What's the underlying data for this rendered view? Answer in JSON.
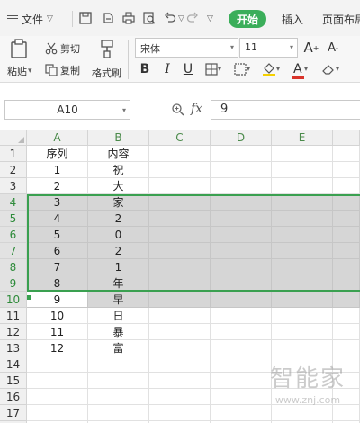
{
  "menubar": {
    "file_label": "文件",
    "start_tab": "开始",
    "insert_tab": "插入",
    "page_layout_tab": "页面布局"
  },
  "ribbon": {
    "paste_label": "粘贴",
    "cut_label": "剪切",
    "copy_label": "复制",
    "format_painter_label": "格式刷",
    "font_name": "宋体",
    "font_size": "11",
    "bold": "B",
    "italic": "I",
    "underline": "U",
    "increase_font": "A",
    "decrease_font": "A",
    "font_color_letter": "A"
  },
  "formula_bar": {
    "name_box": "A10",
    "fx": "fx",
    "value": "9"
  },
  "sheet": {
    "columns": [
      "A",
      "B",
      "C",
      "D",
      "E"
    ],
    "row_numbers": [
      "1",
      "2",
      "3",
      "4",
      "5",
      "6",
      "7",
      "8",
      "9",
      "10",
      "11",
      "12",
      "13",
      "14",
      "15",
      "16",
      "17",
      "18"
    ],
    "rows": [
      [
        "序列",
        "内容"
      ],
      [
        "1",
        "祝"
      ],
      [
        "2",
        "大"
      ],
      [
        "3",
        "家"
      ],
      [
        "4",
        "2"
      ],
      [
        "5",
        "0"
      ],
      [
        "6",
        "2"
      ],
      [
        "7",
        "1"
      ],
      [
        "8",
        "年"
      ],
      [
        "9",
        "早"
      ],
      [
        "10",
        "日"
      ],
      [
        "11",
        "暴"
      ],
      [
        "12",
        "富"
      ],
      [
        "",
        ""
      ],
      [
        "",
        ""
      ],
      [
        "",
        ""
      ],
      [
        "",
        ""
      ],
      [
        "",
        ""
      ]
    ],
    "selected_rows": [
      "4",
      "5",
      "6",
      "7",
      "8",
      "9",
      "10"
    ],
    "active_cell": "A10"
  },
  "watermark": {
    "big": "智能家",
    "small": "www.znj.com"
  },
  "colors": {
    "accent_green": "#3bae5a",
    "selection_gray": "#d6d6d6",
    "font_color_red": "#d9342b",
    "highlight_yellow": "#f5d000"
  }
}
